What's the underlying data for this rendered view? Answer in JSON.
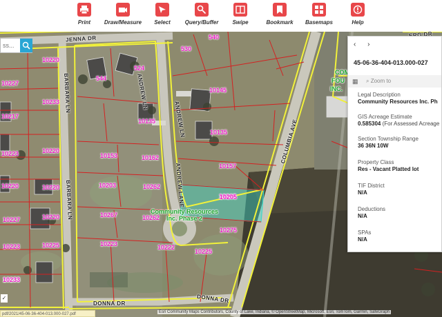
{
  "toolbar": {
    "items": [
      {
        "label": "Print",
        "icon": "print-icon"
      },
      {
        "label": "Draw/Measure",
        "icon": "draw-icon"
      },
      {
        "label": "Select",
        "icon": "select-icon"
      },
      {
        "label": "Query/Buffer",
        "icon": "query-icon"
      },
      {
        "label": "Swipe",
        "icon": "swipe-icon"
      },
      {
        "label": "Bookmark",
        "icon": "bookmark-icon"
      },
      {
        "label": "Basemaps",
        "icon": "basemaps-icon"
      },
      {
        "label": "Help",
        "icon": "help-icon"
      }
    ],
    "accent": "#e8474a"
  },
  "search": {
    "placeholder": "ss..."
  },
  "map": {
    "parcel_color": "#e81cc3",
    "boundary_color": "#f2f23a",
    "lot_line_color": "#d42020",
    "selection_color": "#3fd6c8",
    "streets": [
      "JENNA DR",
      "ANDREW LN",
      "BARBARA LN",
      "ANDREW LN",
      "ANDREW LANE",
      "COLUMBIA AVE",
      "DONNA DR",
      "DONNA DR",
      "ERG DR"
    ],
    "parcels": [
      "10220",
      "10227",
      "10233",
      "10217",
      "10223",
      "10220",
      "10220",
      "10227",
      "10220",
      "10223",
      "10225",
      "10233",
      "544",
      "524",
      "530",
      "540",
      "10145",
      "10135",
      "10135",
      "10153",
      "10157",
      "10162",
      "10203",
      "10262",
      "10265",
      "10267",
      "10262",
      "10205",
      "10275",
      "10223",
      "10222",
      "10225",
      "10233"
    ],
    "subdivision_label": "Community Resources Inc. Phase 2",
    "corner_label_1": "COM",
    "corner_label_2": "FOU",
    "corner_label_3": "INC."
  },
  "panel": {
    "nav_prev": "‹",
    "nav_next": "›",
    "parcel_id": "45-06-36-404-013.000-027",
    "zoom_to": "Zoom to",
    "fields": [
      {
        "label": "Legal Description",
        "value": "Community Resources Inc. Ph",
        "extra": ""
      },
      {
        "label": "GIS Acreage Estimate",
        "value": "0.585304",
        "extra": "(For Assessed Acreage"
      },
      {
        "label": "Section Township Range",
        "value": "36 36N 10W",
        "extra": ""
      },
      {
        "label": "Property Class",
        "value": "Res - Vacant Platted lot",
        "extra": ""
      },
      {
        "label": "TIF District",
        "value": "N/A",
        "extra": ""
      },
      {
        "label": "Deductions",
        "value": "N/A",
        "extra": ""
      },
      {
        "label": "SPAs",
        "value": "N/A",
        "extra": ""
      }
    ]
  },
  "footer": {
    "url": "pdf/2021/45-06-36-404-013.000-027.pdf",
    "attribution": "Esri Community Maps Contributors, County of Lake, Indiana, © OpenStreetMap, Microsoft, Esri, TomTom, Garmin, SafeGraph",
    "checkbox": "✓"
  }
}
